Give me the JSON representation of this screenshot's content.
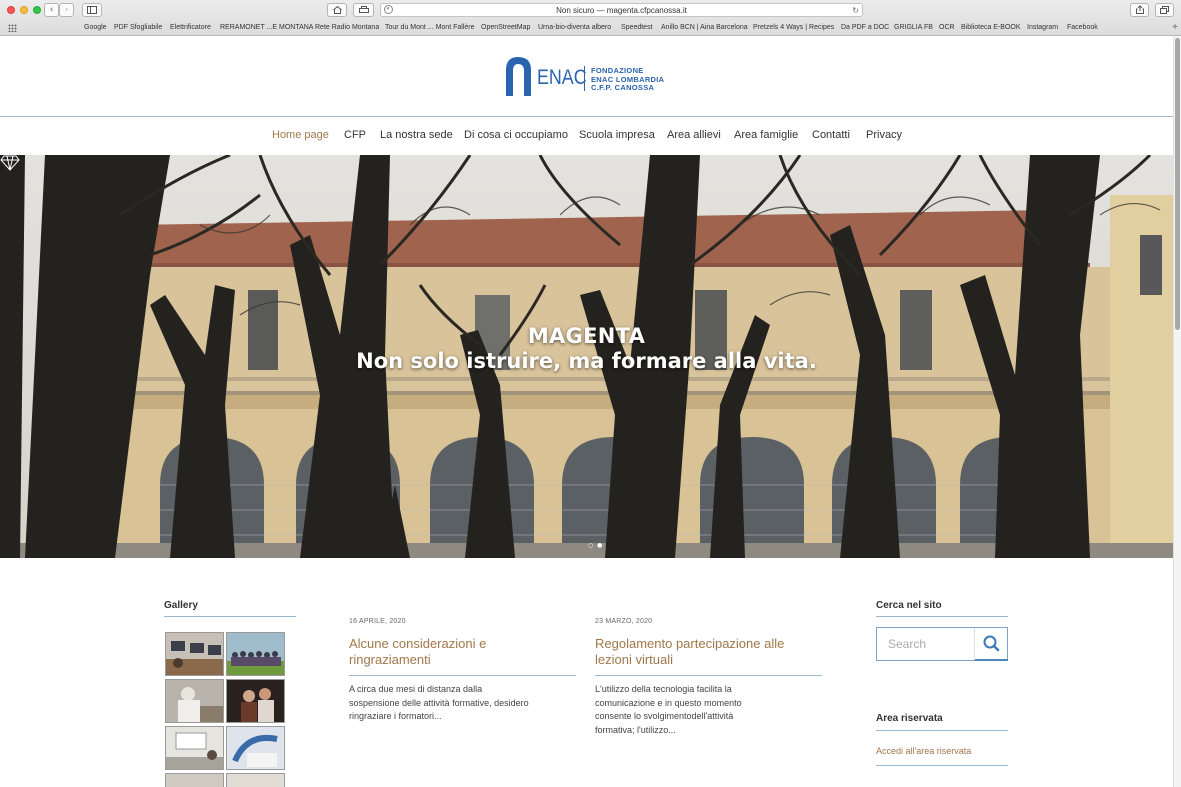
{
  "browser": {
    "address": "Non sicuro — magenta.cfpcanossa.it",
    "bookmarks": [
      "Google",
      "PDF Sfogliabile",
      "Elettrificatore",
      "RERAMONET ...E MONTANA",
      "Rete Radio Montana",
      "Tour du Mont ... Mont Fallère",
      "OpenStreetMap",
      "Urna-bio-diventa albero",
      "Speedtest",
      "Anillo BCN | Aina Barcelona",
      "Pretzels 4 Ways | Recipes",
      "Da PDF a DOC",
      "GRIGLIA FB",
      "OCR",
      "Biblioteca E-BOOK",
      "Instagram",
      "Facebook"
    ]
  },
  "logo": {
    "word": "ENAC",
    "line1": "FONDAZIONE",
    "line2": "ENAC LOMBARDIA",
    "line3": "C.F.P. CANOSSA",
    "color": "#2a64ae"
  },
  "nav": {
    "items": [
      "Home page",
      "CFP",
      "La nostra sede",
      "Di cosa ci occupiamo",
      "Scuola impresa",
      "Area allievi",
      "Area famiglie",
      "Contatti",
      "Privacy"
    ],
    "active_index": 0,
    "active_color": "#a0784a"
  },
  "hero": {
    "icon": "diamond-icon",
    "title": "MAGENTA",
    "subtitle": "Non solo istruire, ma formare alla vita."
  },
  "gallery": {
    "heading": "Gallery"
  },
  "posts": [
    {
      "date": "16 APRILE, 2020",
      "title_line1": "Alcune considerazioni e",
      "title_line2": "ringraziamenti",
      "excerpt_line1": "A circa due mesi di distanza dalla",
      "excerpt_line2": "sospensione delle attività formative, desidero",
      "excerpt_line3": "ringraziare i formatori...",
      "excerpt_line4": ""
    },
    {
      "date": "23 MARZO, 2020",
      "title_line1": "Regolamento partecipazione alle",
      "title_line2": "lezioni virtuali",
      "excerpt_line1": "L'utilizzo della tecnologia facilita la",
      "excerpt_line2": "comunicazione e in questo momento",
      "excerpt_line3": "consente lo svolgimentodell'attività",
      "excerpt_line4": "formativa; l'utilizzo..."
    }
  ],
  "sidebar": {
    "search_heading": "Cerca nel sito",
    "search_placeholder": "Search",
    "reserved_heading": "Area riservata",
    "reserved_link": "Accedi all'area riservata"
  }
}
